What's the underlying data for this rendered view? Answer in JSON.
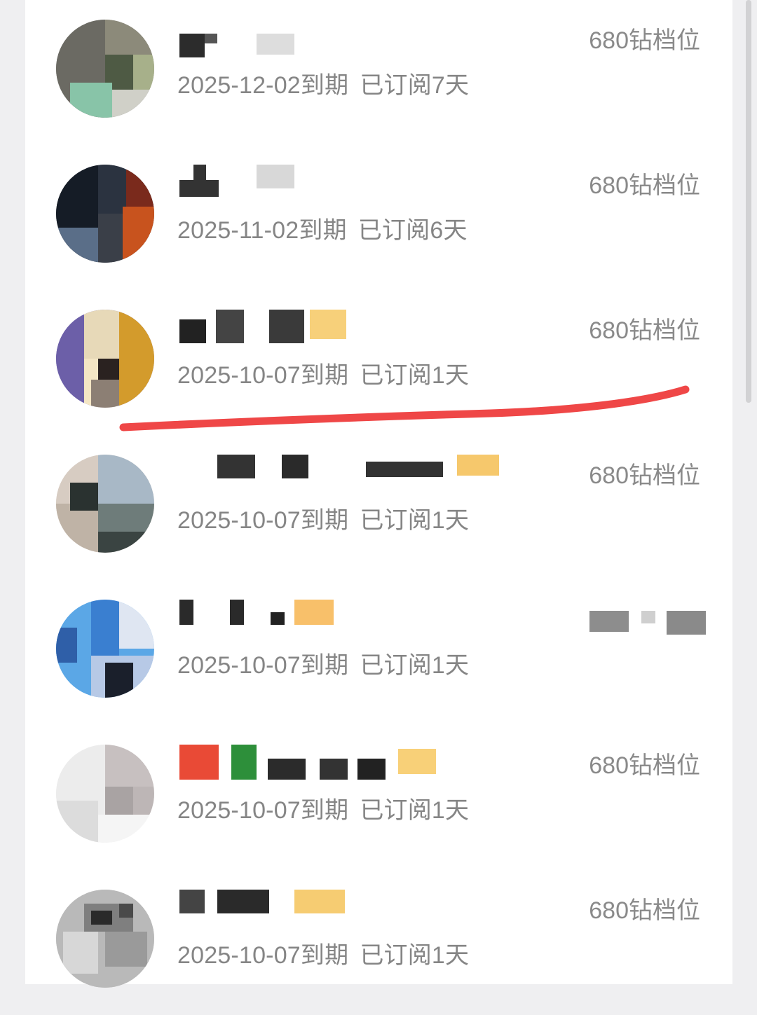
{
  "subscribers": [
    {
      "expiry": "2025-12-02到期",
      "subscribed": "已订阅7天",
      "tier": "680钻档位",
      "avatar_colors": [
        "#6b6a63",
        "#8c8a7a",
        "#a7b08a",
        "#4e5a44",
        "#88c4a8",
        "#d0d0c8"
      ]
    },
    {
      "expiry": "2025-11-02到期",
      "subscribed": "已订阅6天",
      "tier": "680钻档位",
      "avatar_colors": [
        "#151c26",
        "#2b3340",
        "#7a2a1c",
        "#c8531e",
        "#5a6e88",
        "#3a3f48"
      ]
    },
    {
      "expiry": "2025-10-07到期",
      "subscribed": "已订阅1天",
      "tier": "680钻档位",
      "avatar_colors": [
        "#6c5fa8",
        "#e7d9b8",
        "#f4e6c4",
        "#d39b2c",
        "#2a2220",
        "#8c7f74"
      ]
    },
    {
      "expiry": "2025-10-07到期",
      "subscribed": "已订阅1天",
      "tier": "680钻档位",
      "avatar_colors": [
        "#d7ccc2",
        "#a8b8c6",
        "#6e7c7a",
        "#3a4442",
        "#bfb3a6",
        "#2a3230"
      ]
    },
    {
      "expiry": "2025-10-07到期",
      "subscribed": "已订阅1天",
      "tier": "",
      "avatar_colors": [
        "#5ba7e6",
        "#3a7fd0",
        "#1a1f2b",
        "#b7c9e6",
        "#dfe6f2",
        "#2f5fa8"
      ]
    },
    {
      "expiry": "2025-10-07到期",
      "subscribed": "已订阅1天",
      "tier": "680钻档位",
      "avatar_colors": [
        "#ececec",
        "#c7c0c0",
        "#a9a3a3",
        "#dcdcdc",
        "#f5f5f5",
        "#bdb6b6"
      ]
    },
    {
      "expiry": "2025-10-07到期",
      "subscribed": "已订阅1天",
      "tier": "680钻档位",
      "avatar_colors": [
        "#b9b9b9",
        "#7f7f7f",
        "#2a2a2a",
        "#d7d7d7",
        "#9a9a9a",
        "#4a4a4a"
      ]
    }
  ],
  "colors": {
    "background": "#efeff1",
    "panel": "#ffffff",
    "meta_text": "#858585",
    "annotation_line": "#ef4747"
  },
  "icons": [
    "avatar-icon"
  ]
}
